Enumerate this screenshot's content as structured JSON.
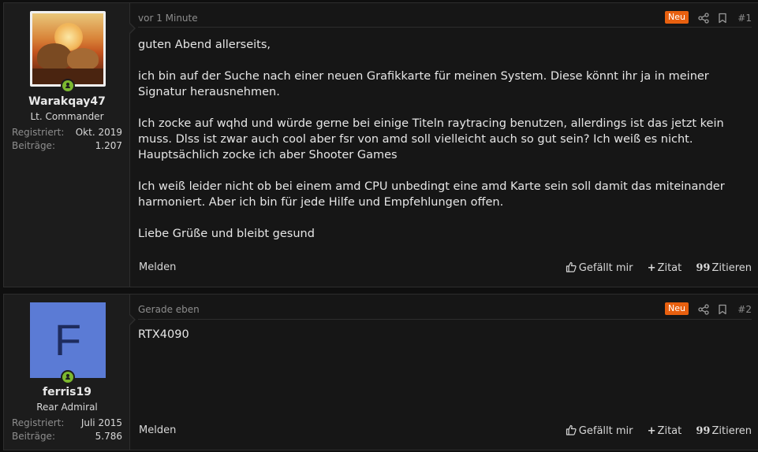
{
  "posts": [
    {
      "user": {
        "name": "Warakqay47",
        "title": "Lt. Commander",
        "avatar_type": "lion-sunset-image",
        "stats": [
          {
            "key": "Registriert:",
            "value": "Okt. 2019"
          },
          {
            "key": "Beiträge:",
            "value": "1.207"
          }
        ]
      },
      "date": "vor 1 Minute",
      "badge": "Neu",
      "number": "#1",
      "paragraphs": [
        [
          "guten Abend allerseits,"
        ],
        [
          "ich bin auf der Suche nach einer neuen Grafikkarte für meinen System. Diese könnt ihr ja in meiner Signatur herausnehmen."
        ],
        [
          "Ich zocke auf wqhd und würde gerne bei einige Titeln raytracing benutzen, allerdings ist das jetzt kein muss. Dlss ist zwar auch cool aber fsr von amd soll vielleicht auch so gut sein? Ich weiß es nicht.",
          "Hauptsächlich zocke ich aber Shooter Games"
        ],
        [
          "Ich weiß leider nicht ob bei einem amd CPU unbedingt eine amd Karte sein soll damit das miteinander harmoniert. Aber ich bin für jede Hilfe und Empfehlungen offen."
        ],
        [
          "Liebe Grüße und bleibt gesund"
        ]
      ]
    },
    {
      "user": {
        "name": "ferris19",
        "title": "Rear Admiral",
        "avatar_letter": "F",
        "avatar_color": "#5b7bd5",
        "stats": [
          {
            "key": "Registriert:",
            "value": "Juli 2015"
          },
          {
            "key": "Beiträge:",
            "value": "5.786"
          }
        ]
      },
      "date": "Gerade eben",
      "badge": "Neu",
      "number": "#2",
      "paragraphs": [
        [
          "RTX4090"
        ]
      ]
    }
  ],
  "footer": {
    "report": "Melden",
    "like": "Gefällt mir",
    "quote": "Zitat",
    "cite": "Zitieren"
  },
  "colors": {
    "badge": "#e8600f",
    "online": "#7cb82f"
  },
  "icons": [
    "share-icon",
    "bookmark-icon",
    "thumbs-up-icon",
    "plus-icon",
    "quote-icon",
    "online-icon"
  ]
}
